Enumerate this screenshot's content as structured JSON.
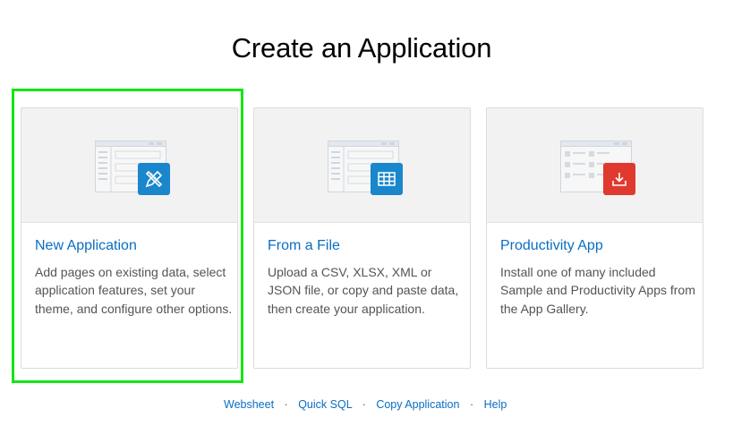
{
  "page": {
    "title": "Create an Application"
  },
  "cards": [
    {
      "title": "New Application",
      "description": "Add pages on existing data, select application features, set your theme, and configure other options.",
      "icon": "pencil-ruler-icon",
      "icon_color": "#1a86cc"
    },
    {
      "title": "From a File",
      "description": "Upload a CSV, XLSX, XML or JSON file, or copy and paste data, then create your application.",
      "icon": "table-grid-icon",
      "icon_color": "#1a86cc"
    },
    {
      "title": "Productivity App",
      "description": "Install one of many included Sample and Productivity Apps from the App Gallery.",
      "icon": "download-icon",
      "icon_color": "#e03a2e"
    }
  ],
  "footer": {
    "links": [
      "Websheet",
      "Quick SQL",
      "Copy Application",
      "Help"
    ],
    "separator": "·"
  },
  "colors": {
    "highlight": "#14e614",
    "link": "#0a6ec2"
  }
}
